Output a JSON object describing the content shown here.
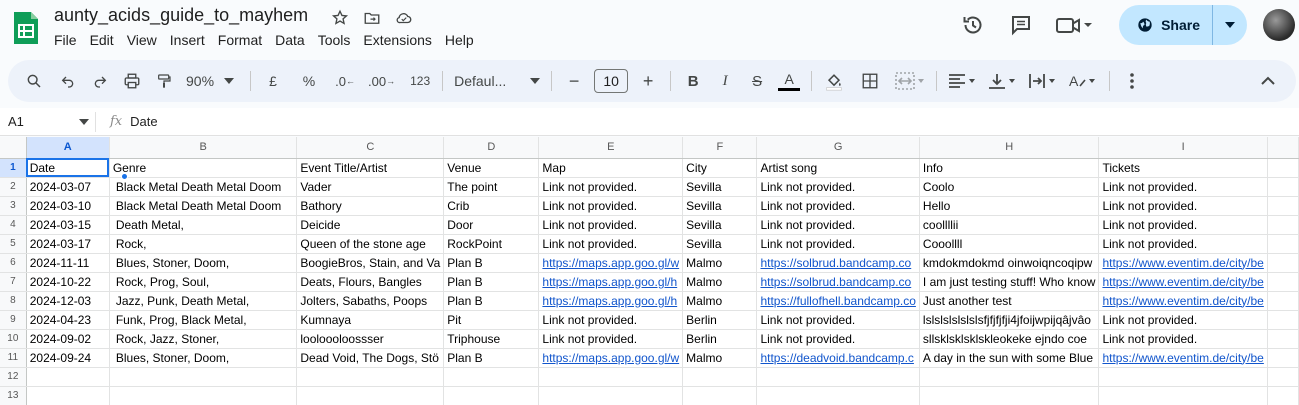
{
  "doc": {
    "title": "aunty_acids_guide_to_mayhem",
    "menu": [
      "File",
      "Edit",
      "View",
      "Insert",
      "Format",
      "Data",
      "Tools",
      "Extensions",
      "Help"
    ],
    "share_label": "Share"
  },
  "toolbar": {
    "zoom": "90%",
    "currency": "£",
    "percent": "%",
    "dec_less": ".0",
    "dec_more": ".00",
    "number_format": "123",
    "font": "Defaul...",
    "font_size": "10"
  },
  "formula_bar": {
    "cell_ref": "A1",
    "fx": "fx",
    "content": "Date"
  },
  "sheet": {
    "columns": [
      "A",
      "B",
      "C",
      "D",
      "E",
      "F",
      "G",
      "H",
      "I"
    ],
    "row_numbers": [
      "1",
      "2",
      "3",
      "4",
      "5",
      "6",
      "7",
      "8",
      "9",
      "10",
      "11",
      "12",
      "13"
    ],
    "rows": [
      [
        "Date",
        "Genre",
        "Event Title/Artist",
        "Venue",
        "Map",
        "City",
        "Artist song",
        "Info",
        "Tickets"
      ],
      [
        "2024-03-07",
        "Black Metal Death Metal Doom",
        "Vader",
        "The point",
        "Link not provided.",
        "Sevilla",
        "Link not provided.",
        "Coolo",
        "Link not provided."
      ],
      [
        "2024-03-10",
        "Black Metal Death Metal Doom",
        "Bathory",
        "Crib",
        "Link not provided.",
        "Sevilla",
        "Link not provided.",
        "Hello",
        "Link not provided."
      ],
      [
        "2024-03-15",
        "Death Metal,",
        "Deicide",
        "Door",
        "Link not provided.",
        "Sevilla",
        "Link not provided.",
        "coollllii",
        "Link not provided."
      ],
      [
        "2024-03-17",
        "Rock,",
        "Queen of the stone age",
        "RockPoint",
        "Link not provided.",
        "Sevilla",
        "Link not provided.",
        "Cooollll",
        "Link not provided."
      ],
      [
        "2024-11-11",
        "Blues, Stoner, Doom,",
        "BoogieBros, Stain, and Va",
        "Plan B",
        "https://maps.app.goo.gl/w",
        "Malmo",
        "https://solbrud.bandcamp.co",
        "kmdokmdokmd oinwoiqncoqipw",
        "https://www.eventim.de/city/be"
      ],
      [
        "2024-10-22",
        "Rock, Prog, Soul,",
        "Deats, Flours, Bangles",
        "Plan B",
        "https://maps.app.goo.gl/h",
        "Malmo",
        "https://solbrud.bandcamp.co",
        "I am just testing stuff! Who know",
        "https://www.eventim.de/city/be"
      ],
      [
        "2024-12-03",
        "Jazz, Punk, Death Metal,",
        "Jolters, Sabaths, Poops",
        "Plan B",
        "https://maps.app.goo.gl/h",
        "Malmo",
        "https://fullofhell.bandcamp.co",
        "Just another test",
        "https://www.eventim.de/city/be"
      ],
      [
        "2024-04-23",
        "Funk, Prog, Black Metal,",
        "Kumnaya",
        "Pit",
        "Link not provided.",
        "Berlin",
        "Link not provided.",
        "lslslslslslslsfjfjfjfji4jfoijwpijqâjvâo",
        "Link not provided."
      ],
      [
        "2024-09-02",
        "Rock, Jazz, Stoner,",
        "looloooloossser",
        "Triphouse",
        "Link not provided.",
        "Berlin",
        "Link not provided.",
        "sllsklsklsklskleokeke ejndo coe",
        "Link not provided."
      ],
      [
        "2024-09-24",
        "Blues, Stoner, Doom,",
        "Dead Void, The Dogs, Stö",
        "Plan B",
        "https://maps.app.goo.gl/w",
        "Malmo",
        "https://deadvoid.bandcamp.c",
        "A day in the sun with some Blue",
        "https://www.eventim.de/city/be"
      ],
      [
        "",
        "",
        "",
        "",
        "",
        "",
        "",
        "",
        ""
      ],
      [
        "",
        "",
        "",
        "",
        "",
        "",
        "",
        "",
        ""
      ]
    ]
  },
  "colors": {
    "accent": "#1a73e8",
    "share_bg": "#c2e7ff",
    "link": "#1155cc",
    "selected_header": "#d3e3fd",
    "logo_green": "#0f9d58"
  }
}
